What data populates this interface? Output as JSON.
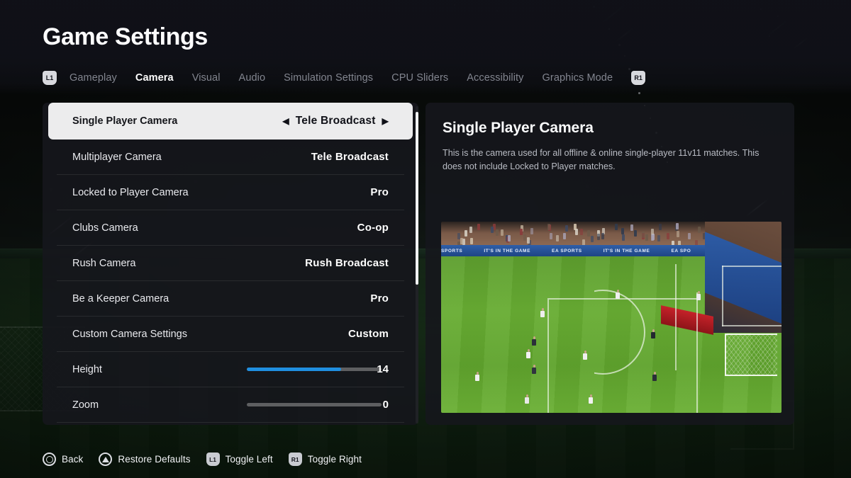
{
  "header": {
    "title": "Game Settings",
    "left_bumper": "L1",
    "right_bumper": "R1",
    "tabs": [
      {
        "label": "Gameplay",
        "active": false
      },
      {
        "label": "Camera",
        "active": true
      },
      {
        "label": "Visual",
        "active": false
      },
      {
        "label": "Audio",
        "active": false
      },
      {
        "label": "Simulation Settings",
        "active": false
      },
      {
        "label": "CPU Sliders",
        "active": false
      },
      {
        "label": "Accessibility",
        "active": false
      },
      {
        "label": "Graphics Mode",
        "active": false
      }
    ]
  },
  "settings_list": {
    "selected_index": 0,
    "left_arrow": "◀",
    "right_arrow": "▶",
    "rows": [
      {
        "label": "Single Player Camera",
        "value": "Tele Broadcast",
        "type": "option",
        "selected": true
      },
      {
        "label": "Multiplayer Camera",
        "value": "Tele Broadcast",
        "type": "option",
        "selected": false
      },
      {
        "label": "Locked to Player Camera",
        "value": "Pro",
        "type": "option",
        "selected": false
      },
      {
        "label": "Clubs Camera",
        "value": "Co-op",
        "type": "option",
        "selected": false
      },
      {
        "label": "Rush Camera",
        "value": "Rush Broadcast",
        "type": "option",
        "selected": false
      },
      {
        "label": "Be a Keeper Camera",
        "value": "Pro",
        "type": "option",
        "selected": false
      },
      {
        "label": "Custom Camera Settings",
        "value": "Custom",
        "type": "option",
        "selected": false
      },
      {
        "label": "Height",
        "value": "14",
        "type": "slider",
        "fill_percent": 70,
        "selected": false
      },
      {
        "label": "Zoom",
        "value": "0",
        "type": "slider",
        "fill_percent": 0,
        "selected": false
      }
    ]
  },
  "detail": {
    "title": "Single Player Camera",
    "description": "This is the camera used for all offline & online single-player 11v11 matches. This does not include Locked to Player matches.",
    "preview_board_text": "SPORTS   IT'S IN THE GAME   EA SPORTS   IT'S IN THE GAME   EA SPO"
  },
  "bottom_bar": {
    "hints": [
      {
        "glyph": "circle",
        "label": "Back"
      },
      {
        "glyph": "triangle",
        "label": "Restore Defaults"
      },
      {
        "glyph": "L1",
        "label": "Toggle Left"
      },
      {
        "glyph": "R1",
        "label": "Toggle Right"
      }
    ]
  },
  "colors": {
    "accent_blue": "#1f8fe0",
    "panel_bg": "#16171c",
    "selected_row_bg": "#ececed",
    "tab_inactive": "#82858f",
    "pitch_green": "#68ad33"
  }
}
